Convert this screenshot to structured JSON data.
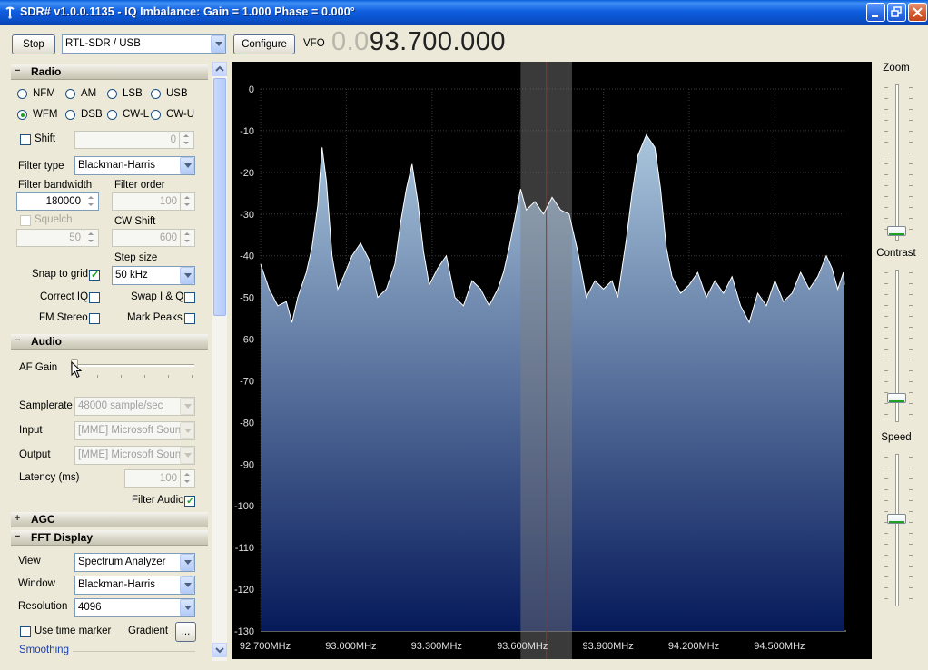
{
  "window": {
    "title": "SDR# v1.0.0.1135 - IQ Imbalance: Gain = 1.000 Phase = 0.000°",
    "colors": {
      "title_bar": "#0a50c8",
      "accent_check": "#21a121"
    }
  },
  "toolbar": {
    "stop_label": "Stop",
    "device": "RTL-SDR / USB",
    "configure_label": "Configure",
    "vfo_label": "VFO",
    "vfo_dim": "0.0",
    "vfo_value": "93.700.000"
  },
  "radio": {
    "header": "Radio",
    "modes": [
      {
        "label": "NFM",
        "selected": false
      },
      {
        "label": "AM",
        "selected": false
      },
      {
        "label": "LSB",
        "selected": false
      },
      {
        "label": "USB",
        "selected": false
      },
      {
        "label": "WFM",
        "selected": true
      },
      {
        "label": "DSB",
        "selected": false
      },
      {
        "label": "CW-L",
        "selected": false
      },
      {
        "label": "CW-U",
        "selected": false
      }
    ],
    "shift_label": "Shift",
    "shift_value": "0",
    "filter_type_label": "Filter type",
    "filter_type": "Blackman-Harris",
    "filter_bandwidth_label": "Filter bandwidth",
    "filter_bandwidth": "180000",
    "filter_order_label": "Filter order",
    "filter_order": "100",
    "squelch_label": "Squelch",
    "squelch_value": "50",
    "cw_shift_label": "CW Shift",
    "cw_shift_value": "600",
    "step_size_label": "Step size",
    "step_size": "50 kHz",
    "snap_to_grid_label": "Snap to grid",
    "correct_iq_label": "Correct IQ",
    "swap_iq_label": "Swap I & Q",
    "fm_stereo_label": "FM Stereo",
    "mark_peaks_label": "Mark Peaks"
  },
  "audio": {
    "header": "Audio",
    "af_gain_label": "AF Gain",
    "samplerate_label": "Samplerate",
    "samplerate": "48000 sample/sec",
    "input_label": "Input",
    "input": "[MME] Microsoft Sound",
    "output_label": "Output",
    "output": "[MME] Microsoft Sound",
    "latency_label": "Latency (ms)",
    "latency": "100",
    "filter_audio_label": "Filter Audio"
  },
  "agc": {
    "header": "AGC"
  },
  "fft": {
    "header": "FFT Display",
    "view_label": "View",
    "view": "Spectrum Analyzer",
    "window_label": "Window",
    "window": "Blackman-Harris",
    "resolution_label": "Resolution",
    "resolution": "4096",
    "use_time_marker_label": "Use  time marker",
    "gradient_label": "Gradient",
    "gradient_button": "...",
    "smoothing_label": "Smoothing"
  },
  "right_panel": {
    "zoom_label": "Zoom",
    "contrast_label": "Contrast",
    "speed_label": "Speed"
  },
  "chart_data": {
    "type": "area",
    "title": "",
    "xlabel": "",
    "ylabel": "",
    "x_unit": "MHz",
    "xlim": [
      92.7,
      94.75
    ],
    "ylim": [
      -130,
      0
    ],
    "y_ticks": [
      "0",
      "-10",
      "-20",
      "-30",
      "-40",
      "-50",
      "-60",
      "-70",
      "-80",
      "-90",
      "-100",
      "-110",
      "-120",
      "-130"
    ],
    "x_ticks": [
      "92.700MHz",
      "93.000MHz",
      "93.300MHz",
      "93.600MHz",
      "93.900MHz",
      "94.200MHz",
      "94.500MHz"
    ],
    "grid": true,
    "tuned_frequency_mhz": 93.7,
    "filter_band_mhz": [
      93.61,
      93.79
    ],
    "colors": {
      "trace": "#ffffff",
      "fill_top": "#a9c6dd",
      "fill_bottom": "#061a5a",
      "tuner_line": "#e01010",
      "filter_band": "#808080"
    },
    "points": [
      [
        92.7,
        -42
      ],
      [
        92.73,
        -48
      ],
      [
        92.76,
        -52
      ],
      [
        92.79,
        -51
      ],
      [
        92.81,
        -56
      ],
      [
        92.83,
        -50
      ],
      [
        92.86,
        -44
      ],
      [
        92.88,
        -38
      ],
      [
        92.9,
        -28
      ],
      [
        92.915,
        -14
      ],
      [
        92.93,
        -22
      ],
      [
        92.95,
        -40
      ],
      [
        92.97,
        -48
      ],
      [
        92.99,
        -45
      ],
      [
        93.02,
        -40
      ],
      [
        93.05,
        -37
      ],
      [
        93.08,
        -41
      ],
      [
        93.11,
        -50
      ],
      [
        93.14,
        -48
      ],
      [
        93.17,
        -42
      ],
      [
        93.19,
        -32
      ],
      [
        93.21,
        -24
      ],
      [
        93.23,
        -18
      ],
      [
        93.25,
        -27
      ],
      [
        93.27,
        -39
      ],
      [
        93.29,
        -47
      ],
      [
        93.32,
        -43
      ],
      [
        93.35,
        -40
      ],
      [
        93.38,
        -50
      ],
      [
        93.41,
        -52
      ],
      [
        93.44,
        -46
      ],
      [
        93.47,
        -48
      ],
      [
        93.5,
        -52
      ],
      [
        93.53,
        -48
      ],
      [
        93.55,
        -44
      ],
      [
        93.57,
        -38
      ],
      [
        93.59,
        -31
      ],
      [
        93.61,
        -24
      ],
      [
        93.63,
        -29
      ],
      [
        93.66,
        -27
      ],
      [
        93.69,
        -30
      ],
      [
        93.72,
        -26
      ],
      [
        93.75,
        -29
      ],
      [
        93.78,
        -30
      ],
      [
        93.81,
        -39
      ],
      [
        93.84,
        -50
      ],
      [
        93.87,
        -46
      ],
      [
        93.9,
        -48
      ],
      [
        93.93,
        -46
      ],
      [
        93.95,
        -50
      ],
      [
        93.98,
        -36
      ],
      [
        94.0,
        -25
      ],
      [
        94.02,
        -16
      ],
      [
        94.05,
        -11
      ],
      [
        94.08,
        -14
      ],
      [
        94.1,
        -24
      ],
      [
        94.12,
        -38
      ],
      [
        94.14,
        -45
      ],
      [
        94.17,
        -49
      ],
      [
        94.2,
        -47
      ],
      [
        94.23,
        -44
      ],
      [
        94.26,
        -50
      ],
      [
        94.29,
        -46
      ],
      [
        94.32,
        -49
      ],
      [
        94.35,
        -45
      ],
      [
        94.38,
        -52
      ],
      [
        94.41,
        -56
      ],
      [
        94.44,
        -49
      ],
      [
        94.47,
        -52
      ],
      [
        94.5,
        -46
      ],
      [
        94.53,
        -51
      ],
      [
        94.56,
        -49
      ],
      [
        94.59,
        -44
      ],
      [
        94.62,
        -48
      ],
      [
        94.65,
        -45
      ],
      [
        94.68,
        -40
      ],
      [
        94.7,
        -43
      ],
      [
        94.72,
        -48
      ],
      [
        94.74,
        -44
      ],
      [
        94.75,
        -47
      ]
    ]
  }
}
